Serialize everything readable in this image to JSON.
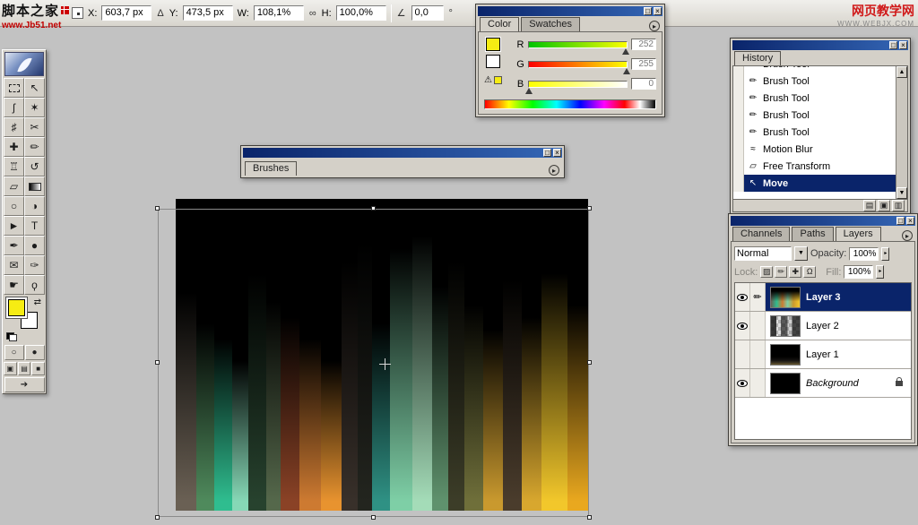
{
  "icons": {
    "maximize": "□",
    "close": "×",
    "menu": "▸",
    "up": "▲",
    "down": "▼",
    "dropdown": "▼",
    "side": "▸",
    "cancel": "⊘",
    "commit": "✓",
    "delta": "Δ",
    "angle": "∠",
    "link": "∞",
    "degree": "°",
    "swap": "⇄",
    "warning": "⚠",
    "toggle_palette": "▤",
    "quickmask_standard": "○",
    "quickmask_mask": "●",
    "screen_standard": "▣",
    "screen_full_menu": "▤",
    "screen_full": "■",
    "imageready": "➔"
  },
  "options_bar": {
    "x_label": "X:",
    "x_value": "603,7 px",
    "y_label": "Y:",
    "y_value": "473,5 px",
    "w_label": "W:",
    "w_value": "108,1%",
    "h_label": "H:",
    "h_value": "100,0%",
    "angle_value": "0,0"
  },
  "logo_left": {
    "title": "脚本之家",
    "url": "www.Jb51.net"
  },
  "logo_right": {
    "title": "网页教学网",
    "url": "WWW.WEBJX.COM"
  },
  "toolbox": {
    "tools": [
      {
        "id": "rectangular-marquee",
        "glyph": "",
        "shape": "dashed-rect"
      },
      {
        "id": "move",
        "glyph": "↖"
      },
      {
        "id": "lasso",
        "glyph": "ʃ"
      },
      {
        "id": "magic-wand",
        "glyph": "✶"
      },
      {
        "id": "crop",
        "glyph": "♯"
      },
      {
        "id": "slice",
        "glyph": "✂"
      },
      {
        "id": "healing-brush",
        "glyph": "✚"
      },
      {
        "id": "brush",
        "glyph": "✏"
      },
      {
        "id": "clone-stamp",
        "glyph": "♖"
      },
      {
        "id": "history-brush",
        "glyph": "↺"
      },
      {
        "id": "eraser",
        "glyph": "▱"
      },
      {
        "id": "gradient",
        "glyph": "",
        "shape": "gradient-box"
      },
      {
        "id": "blur",
        "glyph": "○"
      },
      {
        "id": "dodge",
        "glyph": "◑"
      },
      {
        "id": "path-selection",
        "glyph": "►"
      },
      {
        "id": "type",
        "glyph": "T"
      },
      {
        "id": "pen",
        "glyph": "✒"
      },
      {
        "id": "shape",
        "glyph": "●"
      },
      {
        "id": "notes",
        "glyph": "✉"
      },
      {
        "id": "eyedropper",
        "glyph": "✑"
      },
      {
        "id": "hand",
        "glyph": "☛"
      },
      {
        "id": "zoom",
        "glyph": "ϙ"
      }
    ],
    "foreground_color": "#f6ec13",
    "background_color": "#ffffff"
  },
  "color_palette": {
    "tabs": [
      {
        "label": "Color",
        "active": true
      },
      {
        "label": "Swatches",
        "active": false
      }
    ],
    "channels": [
      {
        "label": "R",
        "value": 252,
        "display": "252",
        "grad_from": "#00c400",
        "grad_to": "#fcff00"
      },
      {
        "label": "G",
        "value": 255,
        "display": "255",
        "grad_from": "#fc0000",
        "grad_to": "#fcff00"
      },
      {
        "label": "B",
        "value": 0,
        "display": "0",
        "grad_from": "#fcff00",
        "grad_to": "#ffffff"
      }
    ],
    "foreground": "#f6ec13",
    "background": "#ffffff"
  },
  "brushes_palette": {
    "tab": "Brushes"
  },
  "history_palette": {
    "tab": "History",
    "items": [
      {
        "label": "Brush Tool",
        "glyph": "✏",
        "clipped": true
      },
      {
        "label": "Brush Tool",
        "glyph": "✏"
      },
      {
        "label": "Brush Tool",
        "glyph": "✏"
      },
      {
        "label": "Brush Tool",
        "glyph": "✏"
      },
      {
        "label": "Brush Tool",
        "glyph": "✏"
      },
      {
        "label": "Motion Blur",
        "glyph": "≈"
      },
      {
        "label": "Free Transform",
        "glyph": "▱"
      },
      {
        "label": "Move",
        "glyph": "↖",
        "selected": true
      }
    ],
    "footer_icons": [
      {
        "name": "new-document-from-state",
        "glyph": "▤"
      },
      {
        "name": "new-snapshot",
        "glyph": "▣"
      },
      {
        "name": "delete-state",
        "glyph": "▥"
      }
    ]
  },
  "layers_palette": {
    "tabs": [
      {
        "label": "Channels",
        "active": false
      },
      {
        "label": "Paths",
        "active": false
      },
      {
        "label": "Layers",
        "active": true
      }
    ],
    "blend_mode": "Normal",
    "opacity_label": "Opacity:",
    "opacity_value": "100%",
    "lock_label": "Lock:",
    "lock_toggles": [
      {
        "name": "lock-transparency",
        "glyph": "▨"
      },
      {
        "name": "lock-image",
        "glyph": "✏"
      },
      {
        "name": "lock-position",
        "glyph": "✚"
      },
      {
        "name": "lock-all",
        "glyph": "Ω"
      }
    ],
    "fill_label": "Fill:",
    "fill_value": "100%",
    "layers": [
      {
        "name": "Layer 3",
        "visible": true,
        "selected": true,
        "thumb": "art",
        "active_brush": true
      },
      {
        "name": "Layer 2",
        "visible": true,
        "thumb": "checker"
      },
      {
        "name": "Layer 1",
        "visible": false,
        "thumb": "dark"
      },
      {
        "name": "Background",
        "visible": true,
        "thumb": "black",
        "italic": true,
        "locked": true
      }
    ]
  },
  "artwork": {
    "stripes": [
      {
        "c": "#6a6054",
        "s": 30,
        "w": 1.0
      },
      {
        "c": "#4f8a5c",
        "s": 40,
        "w": 0.9
      },
      {
        "c": "#2fbd8f",
        "s": 45,
        "w": 0.9
      },
      {
        "c": "#86d8b6",
        "s": 52,
        "w": 0.8
      },
      {
        "c": "#27422e",
        "s": 24,
        "w": 0.9
      },
      {
        "c": "#55684b",
        "s": 33,
        "w": 0.7
      },
      {
        "c": "#8a4226",
        "s": 38,
        "w": 0.9
      },
      {
        "c": "#cd7a31",
        "s": 45,
        "w": 1.1
      },
      {
        "c": "#e8932f",
        "s": 52,
        "w": 1.0
      },
      {
        "c": "#38302a",
        "s": 20,
        "w": 0.8
      },
      {
        "c": "#23251f",
        "s": 14,
        "w": 0.7
      },
      {
        "c": "#2f9184",
        "s": 40,
        "w": 0.9
      },
      {
        "c": "#7ecfa6",
        "s": 16,
        "w": 1.1
      },
      {
        "c": "#a4dcb8",
        "s": 12,
        "w": 1.0
      },
      {
        "c": "#5f926d",
        "s": 28,
        "w": 0.8
      },
      {
        "c": "#3c3d28",
        "s": 20,
        "w": 0.8
      },
      {
        "c": "#6f6f3a",
        "s": 34,
        "w": 0.9
      },
      {
        "c": "#c9992e",
        "s": 42,
        "w": 1.0
      },
      {
        "c": "#4a3c2c",
        "s": 26,
        "w": 0.9
      },
      {
        "c": "#d8a72e",
        "s": 38,
        "w": 1.0
      },
      {
        "c": "#f2c72b",
        "s": 24,
        "w": 1.3
      },
      {
        "c": "#e9a81f",
        "s": 34,
        "w": 1.0
      }
    ]
  }
}
